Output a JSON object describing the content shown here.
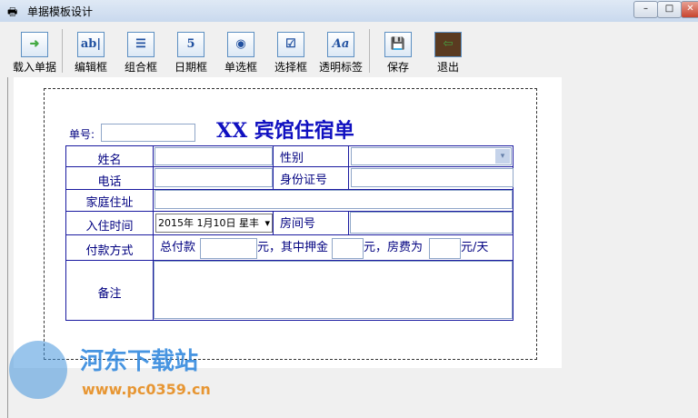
{
  "window": {
    "title": "单据模板设计",
    "min": "–",
    "max": "□",
    "close": "✕"
  },
  "toolbar": [
    {
      "label": "载入单据",
      "icon": "load-icon",
      "glyph": "➜"
    },
    {
      "label": "编辑框",
      "icon": "textbox-icon",
      "glyph": "ab|"
    },
    {
      "label": "组合框",
      "icon": "combobox-icon",
      "glyph": "☰"
    },
    {
      "label": "日期框",
      "icon": "date-icon",
      "glyph": "5"
    },
    {
      "label": "单选框",
      "icon": "radio-icon",
      "glyph": "◉"
    },
    {
      "label": "选择框",
      "icon": "checkbox-icon",
      "glyph": "☑"
    },
    {
      "label": "透明标签",
      "icon": "label-icon",
      "glyph": "Aa"
    },
    {
      "label": "保存",
      "icon": "save-icon",
      "glyph": "💾"
    },
    {
      "label": "退出",
      "icon": "exit-icon",
      "glyph": "⇦"
    }
  ],
  "form": {
    "title": "XX 宾馆住宿单",
    "number_label": "单号:",
    "name": "姓名",
    "gender": "性别",
    "phone": "电话",
    "id": "身份证号",
    "address": "家庭住址",
    "checkin": "入住时间",
    "checkin_value": "2015年  1月10日  星丰",
    "room": "房间号",
    "payment": "付款方式",
    "total": "总付款",
    "yuan_deposit": "元，其中押金",
    "yuan_rate": "元，房费为",
    "per_day": "元/天",
    "remark": "备注"
  },
  "watermark": {
    "name": "河东下载站",
    "url": "www.pc0359.cn"
  }
}
